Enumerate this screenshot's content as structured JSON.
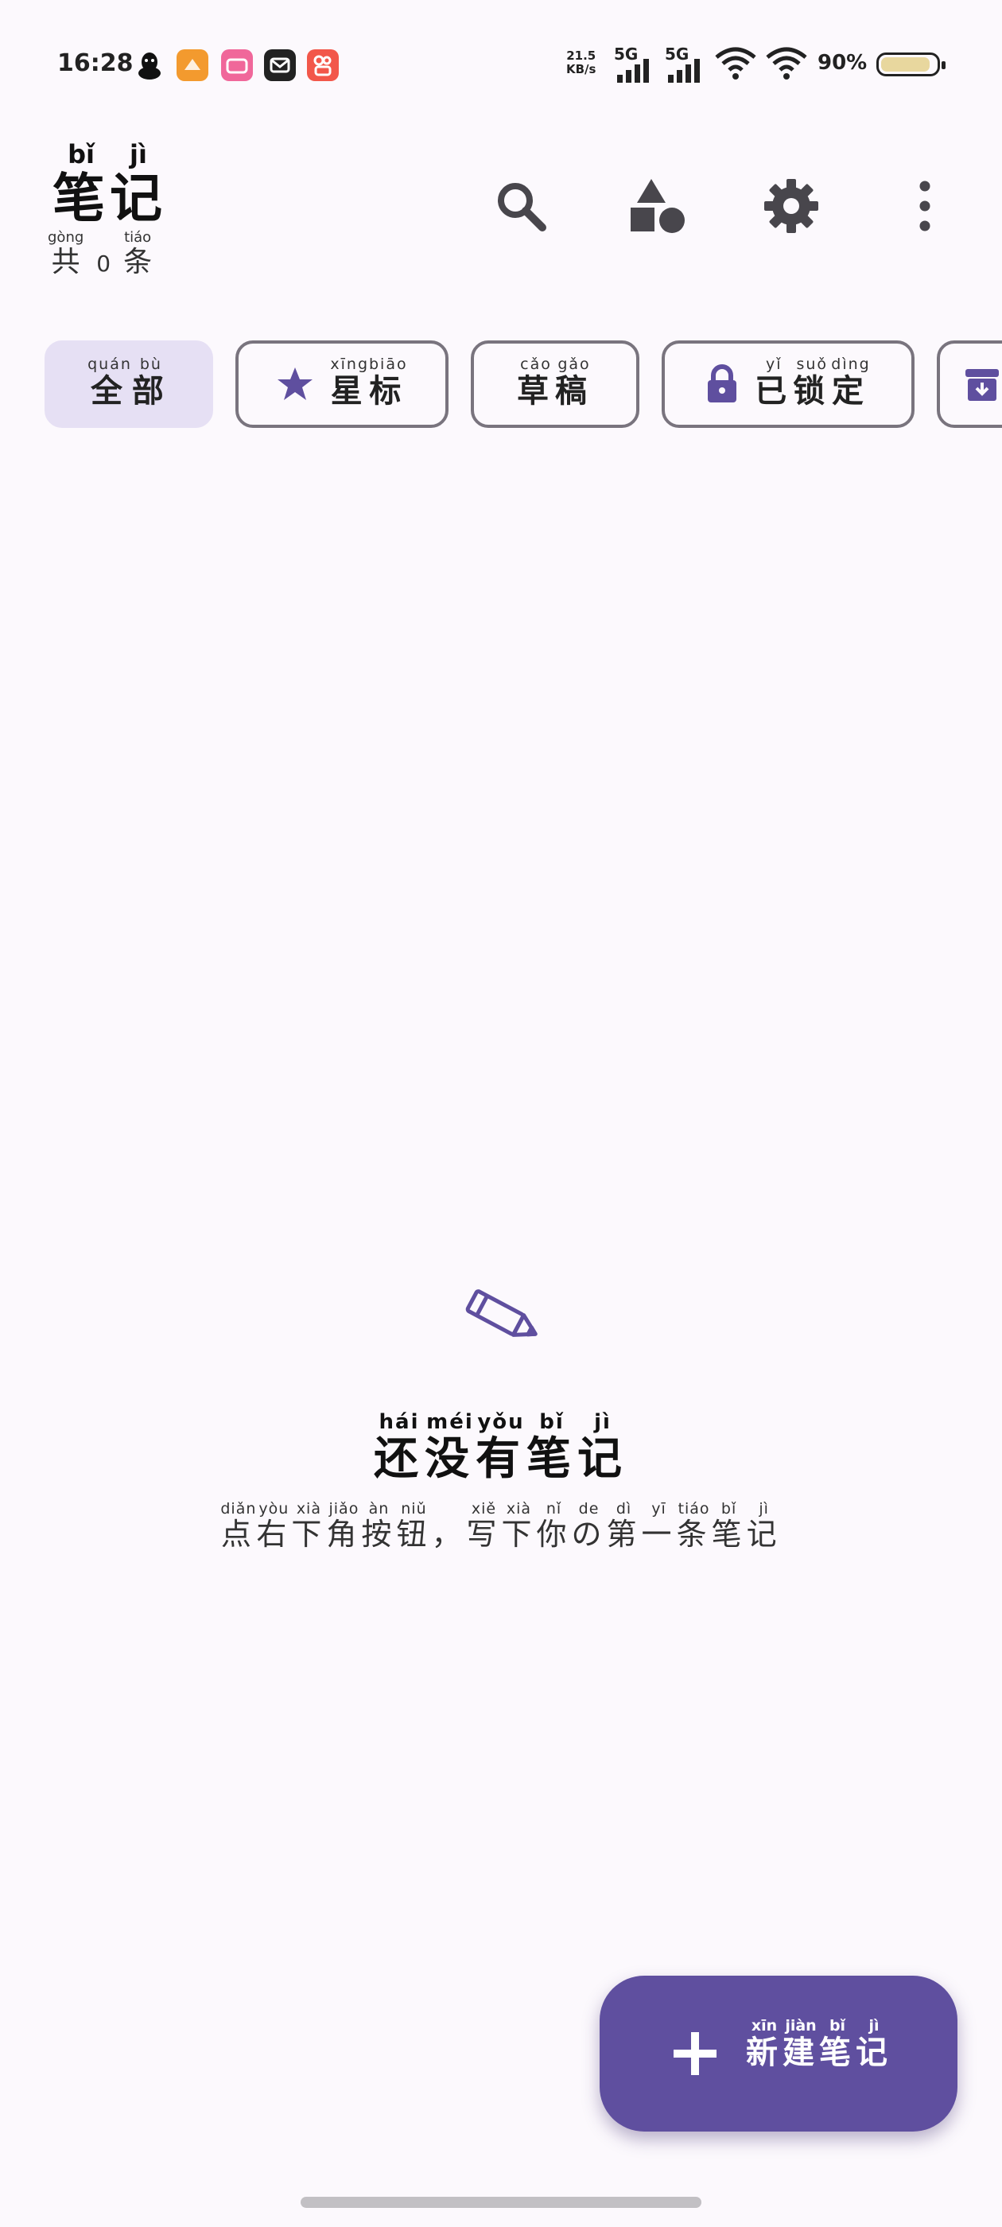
{
  "status_bar": {
    "time": "16:28",
    "net_speed_value": "21.5",
    "net_speed_unit": "KB/s",
    "sim1": "5G",
    "sim2": "5G",
    "battery_pct": "90%",
    "battery_level": 0.9,
    "notification_icons": [
      "qq-icon",
      "app-orange-icon",
      "bilibili-icon",
      "mail-icon",
      "kuaishou-icon"
    ]
  },
  "header": {
    "title": [
      "笔",
      "记"
    ],
    "title_pinyin": [
      "bǐ",
      "jì"
    ],
    "count_prefix": "共",
    "count_prefix_pinyin": "gòng",
    "count": "0",
    "count_suffix": "条",
    "count_suffix_pinyin": "tiáo",
    "actions": [
      "search-icon",
      "shapes-icon",
      "settings-icon",
      "more-vert-icon"
    ]
  },
  "filters": [
    {
      "chars": [
        "全",
        "部"
      ],
      "pinyin": [
        "quán",
        "bù"
      ],
      "active": true
    },
    {
      "chars": [
        "星",
        "标"
      ],
      "pinyin": [
        "xīng",
        "biāo"
      ],
      "icon": "star-icon"
    },
    {
      "chars": [
        "草",
        "稿"
      ],
      "pinyin": [
        "cǎo",
        "gǎo"
      ]
    },
    {
      "chars": [
        "已",
        "锁",
        "定"
      ],
      "pinyin": [
        "yǐ",
        "suǒ",
        "dìng"
      ],
      "icon": "lock-icon"
    },
    {
      "chars": [],
      "pinyin": [],
      "icon": "archive-icon"
    }
  ],
  "empty_state": {
    "icon": "pencil-icon",
    "title_chars": [
      "还",
      "没",
      "有",
      "笔",
      "记"
    ],
    "title_pinyin": [
      "hái",
      "méi",
      "yǒu",
      "bǐ",
      "jì"
    ],
    "subtitle_chars": [
      "点",
      "右",
      "下",
      "角",
      "按",
      "钮",
      "，",
      "写",
      "下",
      "你",
      "の",
      "第",
      "一",
      "条",
      "笔",
      "记"
    ],
    "subtitle_pinyin": [
      "diǎn",
      "yòu",
      "xià",
      "jiǎo",
      "àn",
      "niǔ",
      "",
      "xiě",
      "xià",
      "nǐ",
      "de",
      "dì",
      "yī",
      "tiáo",
      "bǐ",
      "jì"
    ]
  },
  "fab": {
    "icon": "plus-icon",
    "chars": [
      "新",
      "建",
      "笔",
      "记"
    ],
    "pinyin": [
      "xīn",
      "jiàn",
      "bǐ",
      "jì"
    ]
  },
  "colors": {
    "background": "#fcf9fd",
    "accent": "#5f4f9f",
    "chip_active": "#e6e0f4",
    "chip_border": "#79747e",
    "icon_dark": "#48464c"
  }
}
